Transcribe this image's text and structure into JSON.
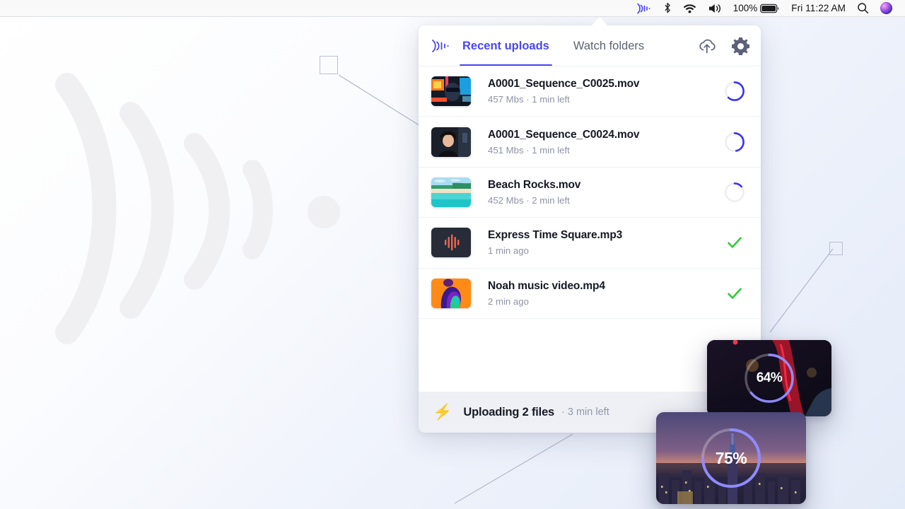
{
  "theme": {
    "accent": "#4a46f6",
    "accent_light": "#8f8bff",
    "success": "#2fcc35",
    "text_primary": "#161824",
    "text_muted": "#8d93a8",
    "panel_bg": "#ffffff",
    "footer_bg": "#eef0f5",
    "desktop_bg": "#e9eefa"
  },
  "menubar": {
    "icons": [
      {
        "name": "signal-waves-icon",
        "label": "app-menu-icon"
      },
      {
        "name": "bluetooth-icon",
        "label": "bluetooth"
      },
      {
        "name": "wifi-icon",
        "label": "wifi"
      },
      {
        "name": "volume-icon",
        "label": "volume"
      }
    ],
    "battery_percent": "100%",
    "clock": "Fri 11:22 AM",
    "search_icon": "search-icon",
    "siri_icon": "siri-icon"
  },
  "panel": {
    "brand_icon": "signal-waves-icon",
    "tabs": [
      {
        "label": "Recent uploads",
        "active": true
      },
      {
        "label": "Watch folders",
        "active": false
      }
    ],
    "actions": [
      {
        "name": "cloud-upload-icon",
        "label": "Upload"
      },
      {
        "name": "gear-icon",
        "label": "Settings"
      }
    ],
    "files": [
      {
        "name": "A0001_Sequence_C0025.mov",
        "meta": "457 Mbs  ·  1 min left",
        "size": "457 Mbs",
        "time": "1 min left",
        "status": "uploading",
        "progress": 62,
        "thumb": "neon-portrait"
      },
      {
        "name": "A0001_Sequence_C0024.mov",
        "meta": "451 Mbs  ·  1 min left",
        "size": "451 Mbs",
        "time": "1 min left",
        "status": "uploading",
        "progress": 47,
        "thumb": "man-portrait"
      },
      {
        "name": "Beach Rocks.mov",
        "meta": "452 Mbs  ·  2 min left",
        "size": "452 Mbs",
        "time": "2 min left",
        "status": "uploading",
        "progress": 14,
        "thumb": "beach"
      },
      {
        "name": "Express Time Square.mp3",
        "meta": "1 min ago",
        "size": "",
        "time": "1 min ago",
        "status": "done",
        "progress": 100,
        "thumb": "audio-waveform"
      },
      {
        "name": "Noah music video.mp4",
        "meta": "2 min ago",
        "size": "",
        "time": "2 min ago",
        "status": "done",
        "progress": 100,
        "thumb": "orange-portrait"
      }
    ],
    "footer": {
      "icon": "bolt-icon",
      "status": "Uploading 2 files",
      "eta": "·  3 min left"
    }
  },
  "progress_cards": [
    {
      "percent": "64%",
      "value": 64,
      "art": "concert-red"
    },
    {
      "percent": "75%",
      "value": 75,
      "art": "city-skyline"
    }
  ]
}
